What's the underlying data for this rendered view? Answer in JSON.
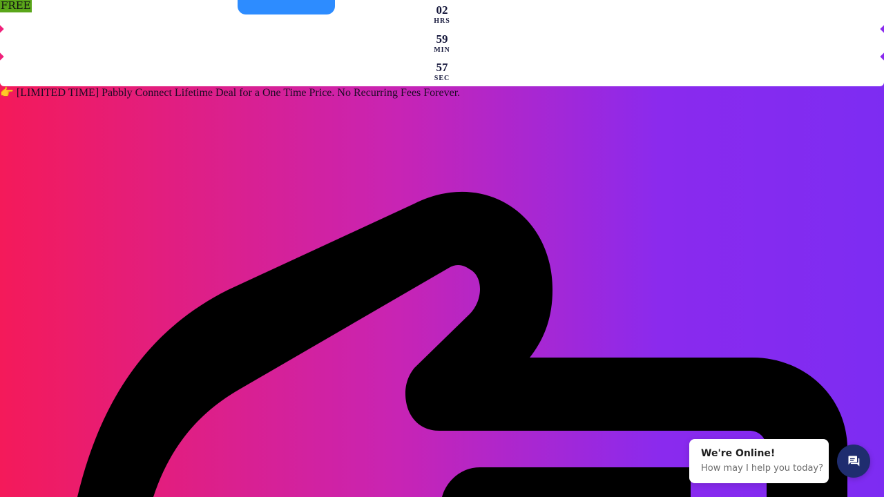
{
  "badge": {
    "label": "FREE"
  },
  "countdown": {
    "hours": {
      "value": "02",
      "label": "HRS"
    },
    "minutes": {
      "value": "59",
      "label": "MIN"
    },
    "seconds": {
      "value": "57",
      "label": "SEC"
    }
  },
  "promo": {
    "emoji": "👉",
    "text": "[LIMITED TIME] Pabbly Connect Lifetime Deal for a One Time Price. No Recurring Fees Forever."
  },
  "chat": {
    "title": "We're Online!",
    "subtitle": "How may I help you today?",
    "icon": "chat-icon"
  },
  "colors": {
    "gradient_start": "#f41a5a",
    "gradient_end": "#7d2cf2",
    "accent_blue": "#2d8cff",
    "badge_green": "#5aa61a",
    "chat_button": "#1f2d6f"
  }
}
